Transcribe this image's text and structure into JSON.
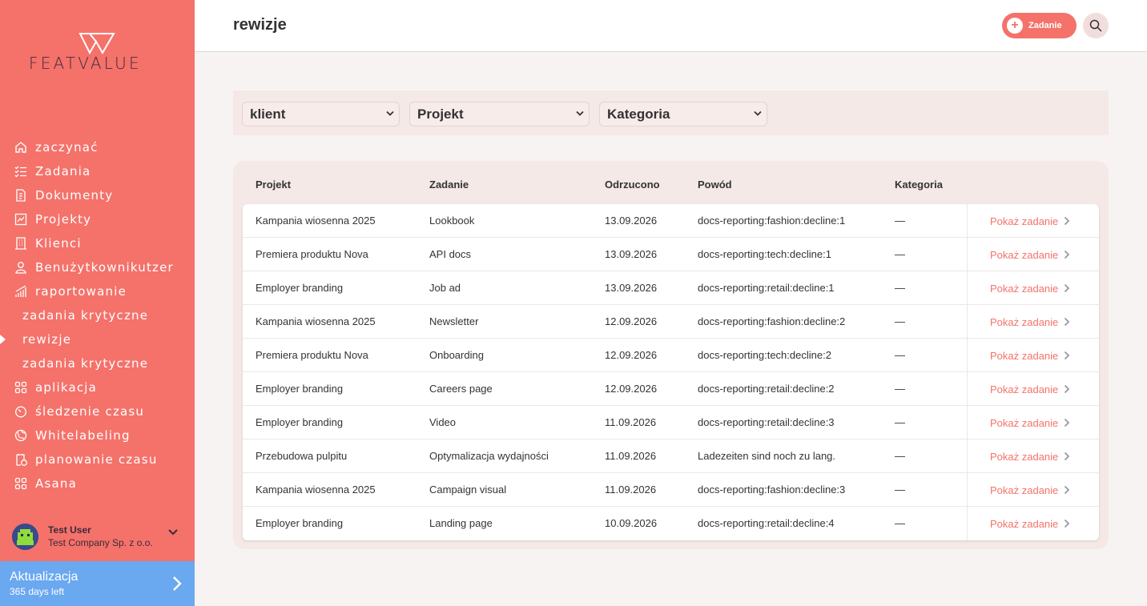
{
  "brand": {
    "logo_text": "FEATVALUE",
    "accent": "#f4726a",
    "upgrade_color": "#6aa8f0"
  },
  "sidebar": {
    "items": [
      {
        "label": "zaczynać",
        "icon": "home-icon"
      },
      {
        "label": "Zadania",
        "icon": "checklist-icon"
      },
      {
        "label": "Dokumenty",
        "icon": "document-icon"
      },
      {
        "label": "Projekty",
        "icon": "projects-icon"
      },
      {
        "label": "Klienci",
        "icon": "building-icon"
      },
      {
        "label": "Benużytkownikutzer",
        "icon": "user-icon"
      },
      {
        "label": "raportowanie",
        "icon": "chart-icon"
      },
      {
        "label": "zadania krytyczne",
        "icon": ""
      },
      {
        "label": "rewizje",
        "icon": ""
      },
      {
        "label": "zadania krytyczne",
        "icon": ""
      },
      {
        "label": "aplikacja",
        "icon": "apps-icon"
      },
      {
        "label": "śledzenie czasu",
        "icon": "timer-icon"
      },
      {
        "label": "Whitelabeling",
        "icon": "globe-icon"
      },
      {
        "label": "planowanie czasu",
        "icon": "planner-icon"
      },
      {
        "label": "Asana",
        "icon": "apps-icon"
      }
    ]
  },
  "user": {
    "name": "Test User",
    "company": "Test Company Sp. z o.o."
  },
  "upgrade": {
    "title": "Aktualizacja",
    "subtitle": "365 days left"
  },
  "header": {
    "title": "rewizje",
    "add_label": "Zadanie"
  },
  "filters": {
    "client": "klient",
    "project": "Projekt",
    "category": "Kategoria"
  },
  "table": {
    "columns": [
      "Projekt",
      "Zadanie",
      "Odrzucono",
      "Powód",
      "Kategoria"
    ],
    "action_label": "Pokaż zadanie",
    "rows": [
      [
        "Kampania wiosenna 2025",
        "Lookbook",
        "13.09.2026",
        "docs-reporting:fashion:decline:1",
        "—"
      ],
      [
        "Premiera produktu Nova",
        "API docs",
        "13.09.2026",
        "docs-reporting:tech:decline:1",
        "—"
      ],
      [
        "Employer branding",
        "Job ad",
        "13.09.2026",
        "docs-reporting:retail:decline:1",
        "—"
      ],
      [
        "Kampania wiosenna 2025",
        "Newsletter",
        "12.09.2026",
        "docs-reporting:fashion:decline:2",
        "—"
      ],
      [
        "Premiera produktu Nova",
        "Onboarding",
        "12.09.2026",
        "docs-reporting:tech:decline:2",
        "—"
      ],
      [
        "Employer branding",
        "Careers page",
        "12.09.2026",
        "docs-reporting:retail:decline:2",
        "—"
      ],
      [
        "Employer branding",
        "Video",
        "11.09.2026",
        "docs-reporting:retail:decline:3",
        "—"
      ],
      [
        "Przebudowa pulpitu",
        "Optymalizacja wydajności",
        "11.09.2026",
        "Ladezeiten sind noch zu lang.",
        "—"
      ],
      [
        "Kampania wiosenna 2025",
        "Campaign visual",
        "11.09.2026",
        "docs-reporting:fashion:decline:3",
        "—"
      ],
      [
        "Employer branding",
        "Landing page",
        "10.09.2026",
        "docs-reporting:retail:decline:4",
        "—"
      ]
    ]
  }
}
